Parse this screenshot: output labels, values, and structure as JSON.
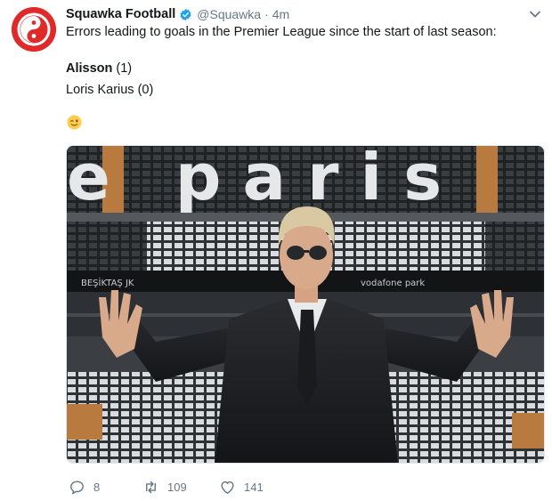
{
  "tweet": {
    "author_name": "Squawka Football",
    "handle": "@Squawka",
    "separator": "·",
    "time": "4m",
    "text_line1": "Errors leading to goals in the Premier League since the start of last season:",
    "text_line2_bold": "Alisson",
    "text_line2_rest": " (1)",
    "text_line3": "Loris Karius (0)",
    "emoji": "winking-face-emoji"
  },
  "media": {
    "stand_letters": "e paris",
    "banner_text": "BEŞİKTAŞ JK",
    "banner_sponsor": "vodafone park"
  },
  "actions": {
    "reply_count": "8",
    "retweet_count": "109",
    "like_count": "141"
  },
  "colors": {
    "brand": "#e02a2a",
    "verified": "#1da1f2",
    "secondary_text": "#657786"
  },
  "icons": {
    "avatar": "squawka-logo-icon",
    "verified": "verified-badge-icon",
    "caret": "chevron-down-icon",
    "reply": "reply-icon",
    "retweet": "retweet-icon",
    "like": "heart-icon"
  }
}
